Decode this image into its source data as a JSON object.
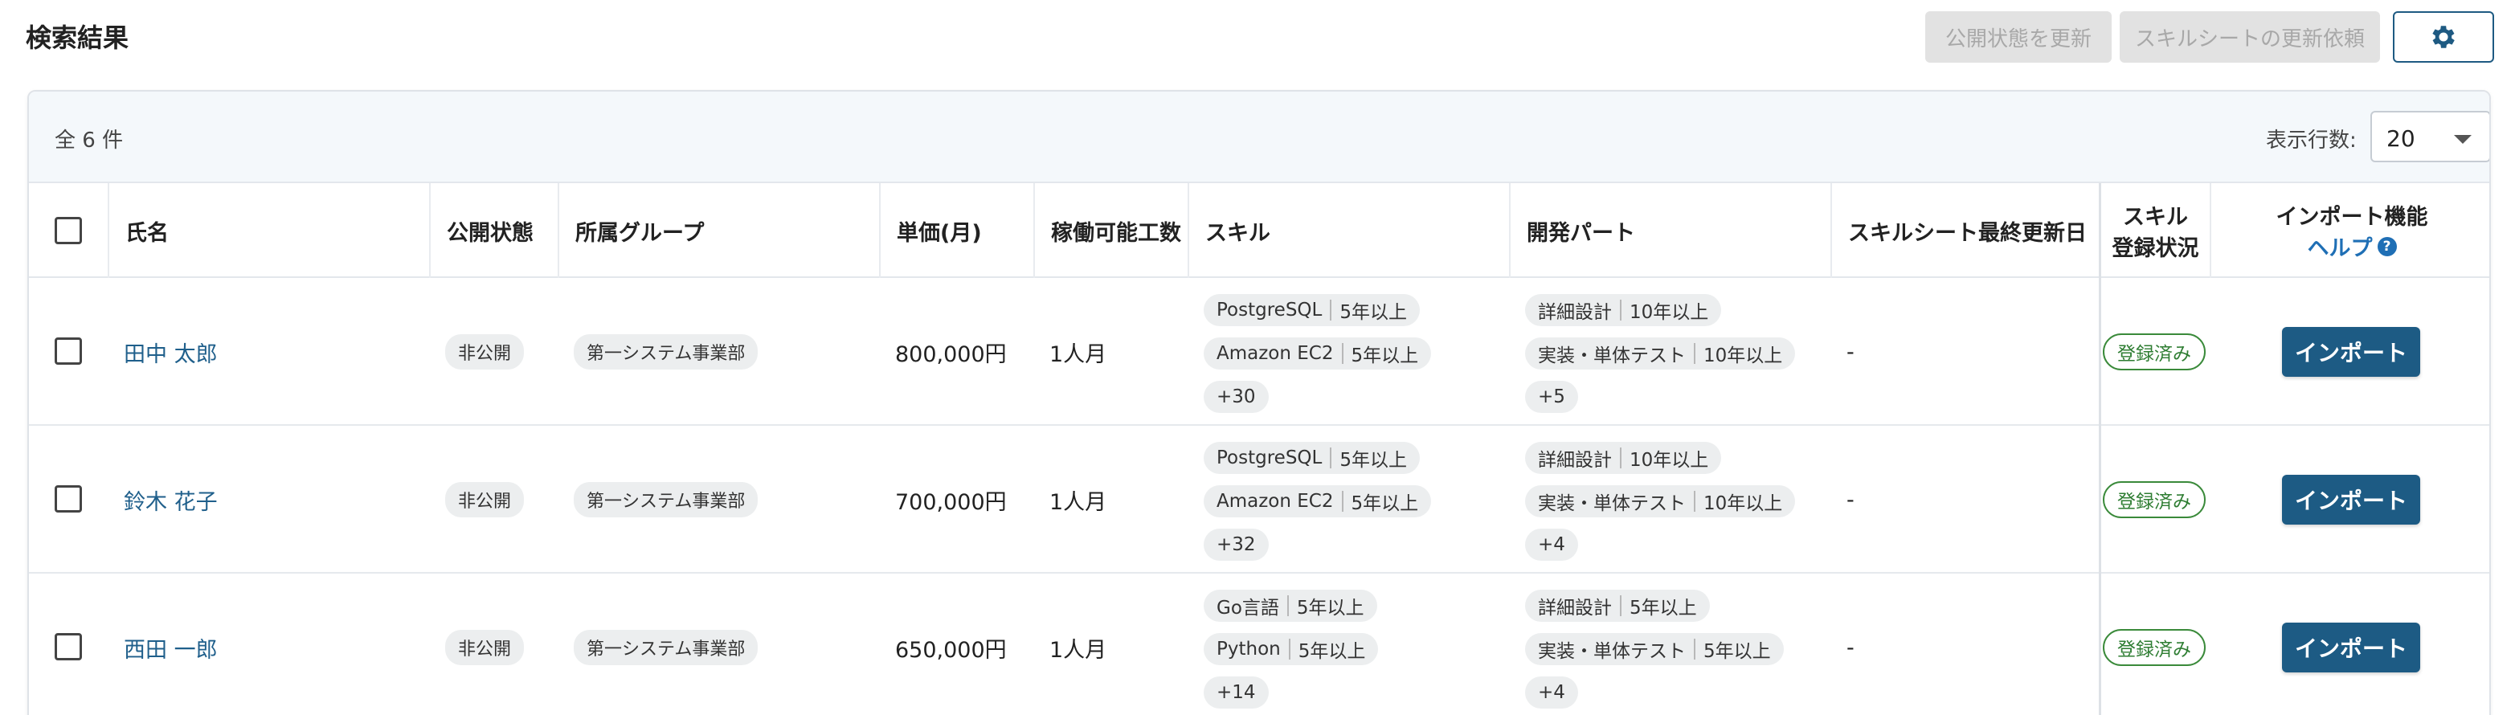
{
  "header": {
    "title": "検索結果",
    "publish_button": "公開状態を更新",
    "request_button": "スキルシートの更新依頼",
    "settings_icon": "gear-icon"
  },
  "toolbar": {
    "total": "全 6 件",
    "rows_label": "表示行数:",
    "rows_value": "20"
  },
  "columns": {
    "name": "氏名",
    "status": "公開状態",
    "group": "所属グループ",
    "price": "単価(月)",
    "workload": "稼働可能工数",
    "skill": "スキル",
    "dev_part": "開発パート",
    "last_update": "スキルシート最終更新日",
    "skill_reg_line1": "スキル",
    "skill_reg_line2": "登録状況",
    "import_title": "インポート機能",
    "import_help": "ヘルプ"
  },
  "rows": [
    {
      "name": "田中 太郎",
      "status": "非公開",
      "group": "第一システム事業部",
      "price": "800,000円",
      "workload": "1人月",
      "skills": [
        {
          "name": "PostgreSQL",
          "years": "5年以上"
        },
        {
          "name": "Amazon EC2",
          "years": "5年以上"
        }
      ],
      "skills_more": "+30",
      "parts": [
        {
          "name": "詳細設計",
          "years": "10年以上"
        },
        {
          "name": "実装・単体テスト",
          "years": "10年以上"
        }
      ],
      "parts_more": "+5",
      "last_update": "-",
      "reg_status": "登録済み",
      "import_label": "インポート"
    },
    {
      "name": "鈴木 花子",
      "status": "非公開",
      "group": "第一システム事業部",
      "price": "700,000円",
      "workload": "1人月",
      "skills": [
        {
          "name": "PostgreSQL",
          "years": "5年以上"
        },
        {
          "name": "Amazon EC2",
          "years": "5年以上"
        }
      ],
      "skills_more": "+32",
      "parts": [
        {
          "name": "詳細設計",
          "years": "10年以上"
        },
        {
          "name": "実装・単体テスト",
          "years": "10年以上"
        }
      ],
      "parts_more": "+4",
      "last_update": "-",
      "reg_status": "登録済み",
      "import_label": "インポート"
    },
    {
      "name": "西田 一郎",
      "status": "非公開",
      "group": "第一システム事業部",
      "price": "650,000円",
      "workload": "1人月",
      "skills": [
        {
          "name": "Go言語",
          "years": "5年以上"
        },
        {
          "name": "Python",
          "years": "5年以上"
        }
      ],
      "skills_more": "+14",
      "parts": [
        {
          "name": "詳細設計",
          "years": "5年以上"
        },
        {
          "name": "実装・単体テスト",
          "years": "5年以上"
        }
      ],
      "parts_more": "+4",
      "last_update": "-",
      "reg_status": "登録済み",
      "import_label": "インポート"
    }
  ],
  "colors": {
    "primary": "#1d5b84",
    "link": "#1f5f8b",
    "help": "#1f6fb5",
    "success": "#2e7d32",
    "disabled_bg": "#e2e2e2"
  }
}
